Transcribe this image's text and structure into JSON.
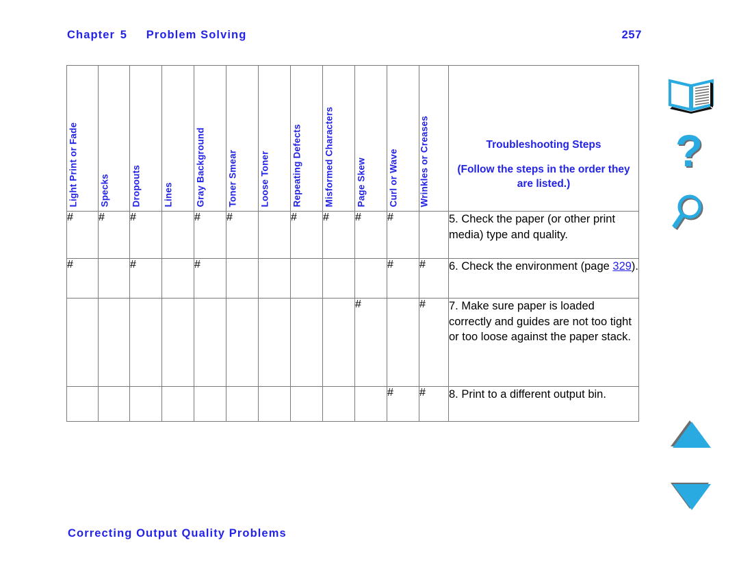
{
  "header": {
    "chapter_label": "Chapter",
    "chapter_number": "5",
    "title": "Problem Solving",
    "page_number": "257"
  },
  "footer": {
    "section_title": "Correcting Output Quality Problems"
  },
  "table": {
    "column_headers": [
      "Light Print or Fade",
      "Specks",
      "Dropouts",
      "Lines",
      "Gray Background",
      "Toner Smear",
      "Loose Toner",
      "Repeating Defects",
      "Misformed Characters",
      "Page Skew",
      "Curl or Wave",
      "Wrinkles or Creases"
    ],
    "steps_header_title": "Troubleshooting Steps",
    "steps_header_note": "(Follow the steps in the order they are listed.)",
    "mark_symbol": "#",
    "rows": [
      {
        "marks": [
          true,
          true,
          true,
          false,
          true,
          true,
          false,
          true,
          true,
          true,
          true,
          false
        ],
        "step_text_before_link": "5. Check the paper (or other print media) type and quality.",
        "link_text": "",
        "step_text_after_link": ""
      },
      {
        "marks": [
          true,
          false,
          true,
          false,
          true,
          false,
          false,
          false,
          false,
          false,
          true,
          true
        ],
        "step_text_before_link": "6. Check the environment (page ",
        "link_text": "329",
        "step_text_after_link": ")."
      },
      {
        "marks": [
          false,
          false,
          false,
          false,
          false,
          false,
          false,
          false,
          false,
          true,
          false,
          true
        ],
        "step_text_before_link": "7. Make sure paper is loaded correctly and guides are not too tight or too loose against the paper stack.",
        "link_text": "",
        "step_text_after_link": ""
      },
      {
        "marks": [
          false,
          false,
          false,
          false,
          false,
          false,
          false,
          false,
          false,
          false,
          true,
          true
        ],
        "step_text_before_link": "8. Print to a different output bin.",
        "link_text": "",
        "step_text_after_link": ""
      }
    ]
  },
  "rail": {
    "icons": [
      {
        "name": "book-icon",
        "label": "Index / Contents"
      },
      {
        "name": "question-mark-icon",
        "label": "Help"
      },
      {
        "name": "magnifier-icon",
        "label": "Search"
      },
      {
        "name": "triangle-up-icon",
        "label": "Previous Page"
      },
      {
        "name": "triangle-down-icon",
        "label": "Next Page"
      }
    ]
  },
  "colors": {
    "accent_blue": "#2323e6",
    "icon_cyan": "#29abe2",
    "icon_shadow": "#6d6d6d",
    "table_border": "#7a7a7a",
    "text_black": "#000000"
  }
}
